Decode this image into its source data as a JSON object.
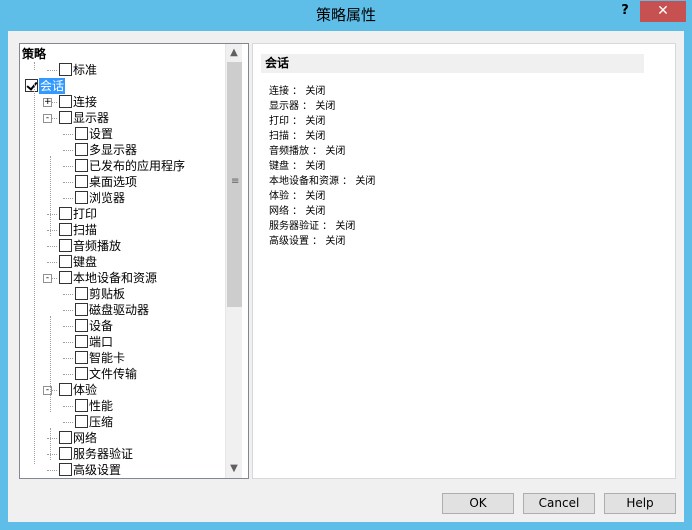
{
  "window": {
    "title": "策略属性",
    "help_label": "?",
    "close_label": "✕"
  },
  "tree": {
    "root": "策略",
    "items": [
      {
        "label": "标准",
        "level": 1,
        "checked": false,
        "expander": null
      },
      {
        "label": "会话",
        "level": 0,
        "checked": true,
        "selected": true,
        "expander": null
      },
      {
        "label": "连接",
        "level": 1,
        "checked": false,
        "expander": "+"
      },
      {
        "label": "显示器",
        "level": 1,
        "checked": false,
        "expander": "-"
      },
      {
        "label": "设置",
        "level": 2,
        "checked": false,
        "expander": null
      },
      {
        "label": "多显示器",
        "level": 2,
        "checked": false,
        "expander": null
      },
      {
        "label": "已发布的应用程序",
        "level": 2,
        "checked": false,
        "expander": null
      },
      {
        "label": "桌面选项",
        "level": 2,
        "checked": false,
        "expander": null
      },
      {
        "label": "浏览器",
        "level": 2,
        "checked": false,
        "expander": null
      },
      {
        "label": "打印",
        "level": 1,
        "checked": false,
        "expander": null
      },
      {
        "label": "扫描",
        "level": 1,
        "checked": false,
        "expander": null
      },
      {
        "label": "音频播放",
        "level": 1,
        "checked": false,
        "expander": null
      },
      {
        "label": "键盘",
        "level": 1,
        "checked": false,
        "expander": null
      },
      {
        "label": "本地设备和资源",
        "level": 1,
        "checked": false,
        "expander": "-"
      },
      {
        "label": "剪贴板",
        "level": 2,
        "checked": false,
        "expander": null
      },
      {
        "label": "磁盘驱动器",
        "level": 2,
        "checked": false,
        "expander": null
      },
      {
        "label": "设备",
        "level": 2,
        "checked": false,
        "expander": null
      },
      {
        "label": "端口",
        "level": 2,
        "checked": false,
        "expander": null
      },
      {
        "label": "智能卡",
        "level": 2,
        "checked": false,
        "expander": null
      },
      {
        "label": "文件传输",
        "level": 2,
        "checked": false,
        "expander": null
      },
      {
        "label": "体验",
        "level": 1,
        "checked": false,
        "expander": "-"
      },
      {
        "label": "性能",
        "level": 2,
        "checked": false,
        "expander": null
      },
      {
        "label": "压缩",
        "level": 2,
        "checked": false,
        "expander": null
      },
      {
        "label": "网络",
        "level": 1,
        "checked": false,
        "expander": null
      },
      {
        "label": "服务器验证",
        "level": 1,
        "checked": false,
        "expander": null
      },
      {
        "label": "高级设置",
        "level": 1,
        "checked": false,
        "expander": null
      }
    ]
  },
  "scrollbar": {
    "up": "▲",
    "down": "▼",
    "grip": "≡"
  },
  "info": {
    "title": "会话",
    "lines": [
      "连接 ： 关闭",
      "显示器 ： 关闭",
      "打印 ： 关闭",
      "扫描 ： 关闭",
      "音频播放 ： 关闭",
      "键盘 ： 关闭",
      "本地设备和资源 ： 关闭",
      "体验 ： 关闭",
      "网络 ： 关闭",
      "服务器验证 ： 关闭",
      "高级设置 ： 关闭"
    ]
  },
  "buttons": {
    "ok": "OK",
    "cancel": "Cancel",
    "help": "Help"
  }
}
